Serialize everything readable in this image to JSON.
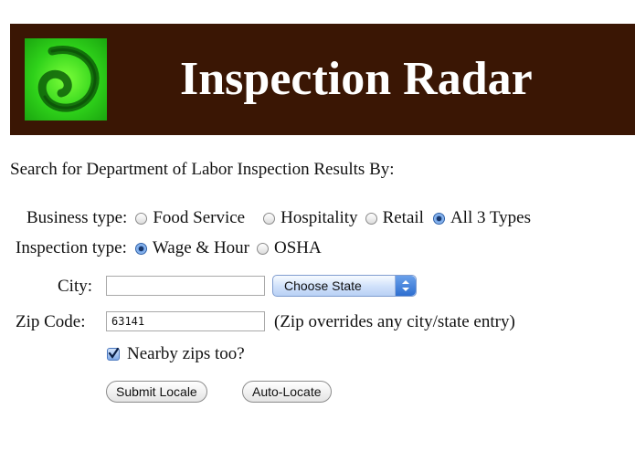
{
  "header": {
    "title": "Inspection Radar",
    "logo_icon": "green-swirl-logo",
    "background_color": "#3a1604",
    "logo_color": "#2fd21a"
  },
  "intro": "Search for Department of Labor Inspection Results By:",
  "business_type": {
    "label": "Business type:",
    "options": [
      "Food Service",
      "Hospitality",
      "Retail",
      "All 3 Types"
    ],
    "selected": "All 3 Types"
  },
  "inspection_type": {
    "label": "Inspection type:",
    "options": [
      "Wage & Hour",
      "OSHA"
    ],
    "selected": "Wage & Hour"
  },
  "city": {
    "label": "City:",
    "value": ""
  },
  "state": {
    "selected": "Choose State"
  },
  "zip": {
    "label": "Zip Code:",
    "value": "63141",
    "note": "(Zip overrides any city/state entry)"
  },
  "nearby": {
    "label": "Nearby zips too?",
    "checked": true
  },
  "buttons": {
    "submit": "Submit Locale",
    "auto_locate": "Auto-Locate"
  }
}
